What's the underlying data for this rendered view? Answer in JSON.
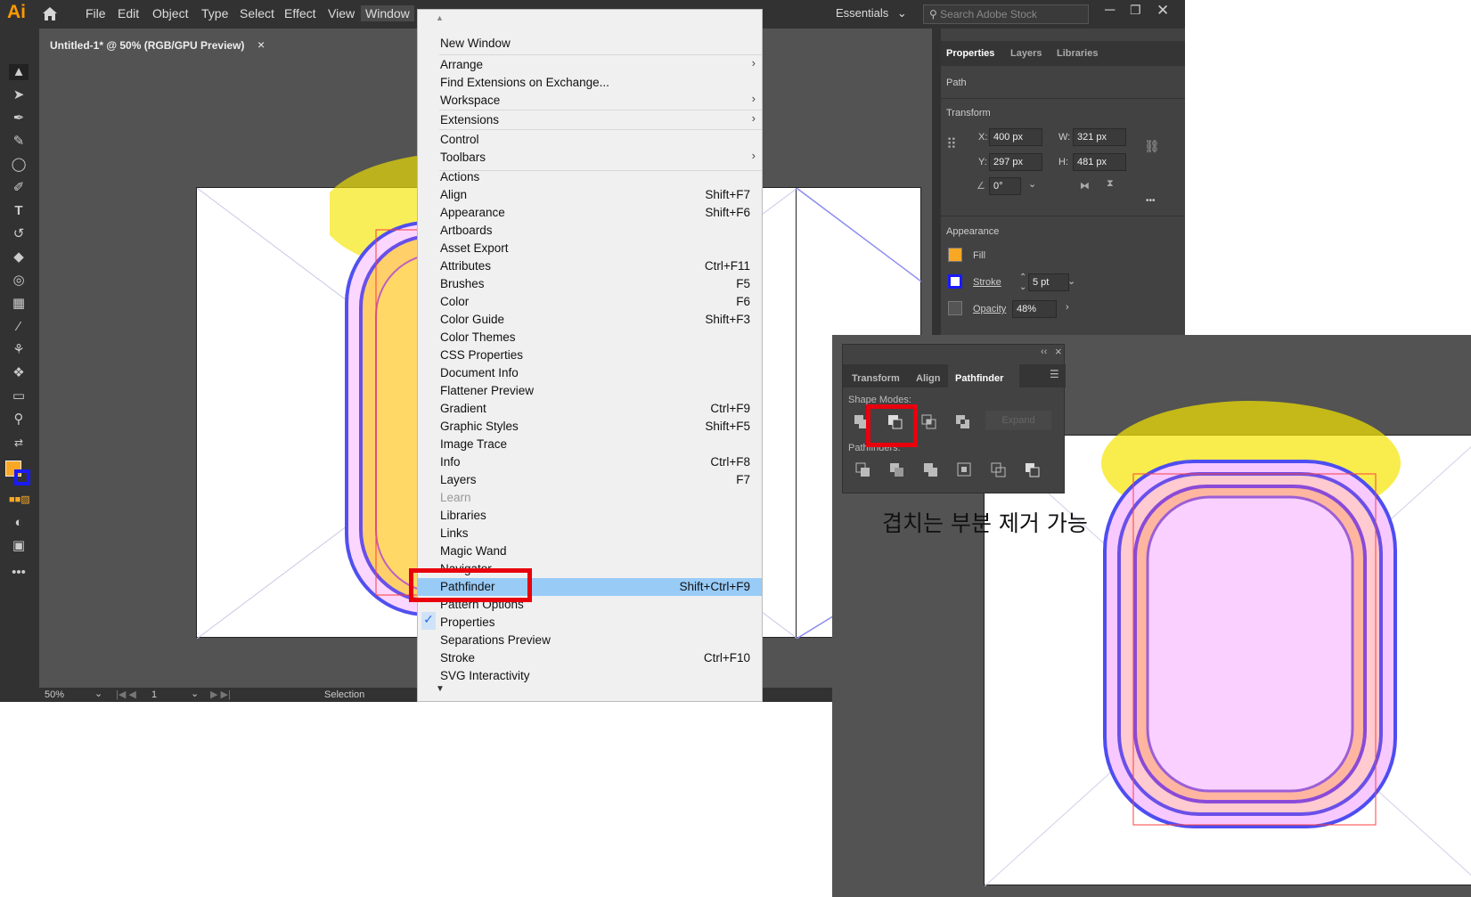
{
  "app": {
    "logo": "Ai",
    "menus": [
      "File",
      "Edit",
      "Object",
      "Type",
      "Select",
      "Effect",
      "View",
      "Window"
    ],
    "workspace": "Essentials",
    "search_placeholder": "Search Adobe Stock",
    "doc_tab": "Untitled-1* @ 50% (RGB/GPU Preview)",
    "tab_close": "×"
  },
  "status": {
    "zoom": "50%",
    "page": "1",
    "tool_name": "Selection"
  },
  "properties": {
    "tabs": [
      "Properties",
      "Layers",
      "Libraries"
    ],
    "object_type": "Path",
    "transform_title": "Transform",
    "x_label": "X:",
    "x_value": "400 px",
    "y_label": "Y:",
    "y_value": "297 px",
    "w_label": "W:",
    "w_value": "321 px",
    "h_label": "H:",
    "h_value": "481 px",
    "rotate_value": "0°",
    "appearance_title": "Appearance",
    "fill_label": "Fill",
    "stroke_label": "Stroke",
    "stroke_value": "5 pt",
    "opacity_label": "Opacity",
    "opacity_value": "48%",
    "more": "•••"
  },
  "colors": {
    "fill": "#f9a825",
    "stroke": "#1a1aff",
    "menu_highlight": "#99cbf7",
    "callout": "#e8000d"
  },
  "window_menu": {
    "items": [
      {
        "label": "New Window",
        "shortcut": "",
        "submenu": false
      },
      {
        "label": "Arrange",
        "shortcut": "",
        "submenu": true
      },
      {
        "label": "Find Extensions on Exchange...",
        "shortcut": "",
        "submenu": false
      },
      {
        "label": "Workspace",
        "shortcut": "",
        "submenu": true
      },
      {
        "label": "Extensions",
        "shortcut": "",
        "submenu": true
      },
      {
        "label": "Control",
        "shortcut": "",
        "submenu": false
      },
      {
        "label": "Toolbars",
        "shortcut": "",
        "submenu": true
      },
      {
        "label": "Actions",
        "shortcut": "",
        "submenu": false
      },
      {
        "label": "Align",
        "shortcut": "Shift+F7",
        "submenu": false
      },
      {
        "label": "Appearance",
        "shortcut": "Shift+F6",
        "submenu": false
      },
      {
        "label": "Artboards",
        "shortcut": "",
        "submenu": false
      },
      {
        "label": "Asset Export",
        "shortcut": "",
        "submenu": false
      },
      {
        "label": "Attributes",
        "shortcut": "Ctrl+F11",
        "submenu": false
      },
      {
        "label": "Brushes",
        "shortcut": "F5",
        "submenu": false
      },
      {
        "label": "Color",
        "shortcut": "F6",
        "submenu": false
      },
      {
        "label": "Color Guide",
        "shortcut": "Shift+F3",
        "submenu": false
      },
      {
        "label": "Color Themes",
        "shortcut": "",
        "submenu": false
      },
      {
        "label": "CSS Properties",
        "shortcut": "",
        "submenu": false
      },
      {
        "label": "Document Info",
        "shortcut": "",
        "submenu": false
      },
      {
        "label": "Flattener Preview",
        "shortcut": "",
        "submenu": false
      },
      {
        "label": "Gradient",
        "shortcut": "Ctrl+F9",
        "submenu": false
      },
      {
        "label": "Graphic Styles",
        "shortcut": "Shift+F5",
        "submenu": false
      },
      {
        "label": "Image Trace",
        "shortcut": "",
        "submenu": false
      },
      {
        "label": "Info",
        "shortcut": "Ctrl+F8",
        "submenu": false
      },
      {
        "label": "Layers",
        "shortcut": "F7",
        "submenu": false
      },
      {
        "label": "Learn",
        "shortcut": "",
        "submenu": false,
        "disabled": true
      },
      {
        "label": "Libraries",
        "shortcut": "",
        "submenu": false
      },
      {
        "label": "Links",
        "shortcut": "",
        "submenu": false
      },
      {
        "label": "Magic Wand",
        "shortcut": "",
        "submenu": false
      },
      {
        "label": "Navigator",
        "shortcut": "",
        "submenu": false
      },
      {
        "label": "Pathfinder",
        "shortcut": "Shift+Ctrl+F9",
        "submenu": false,
        "selected": true
      },
      {
        "label": "Pattern Options",
        "shortcut": "",
        "submenu": false
      },
      {
        "label": "Properties",
        "shortcut": "",
        "submenu": false,
        "checked": true
      },
      {
        "label": "Separations Preview",
        "shortcut": "",
        "submenu": false
      },
      {
        "label": "Stroke",
        "shortcut": "Ctrl+F10",
        "submenu": false
      },
      {
        "label": "SVG Interactivity",
        "shortcut": "",
        "submenu": false
      }
    ]
  },
  "pathfinder_panel": {
    "tabs": [
      "Transform",
      "Align",
      "Pathfinder"
    ],
    "shape_modes_label": "Shape Modes:",
    "expand_label": "Expand",
    "pathfinders_label": "Pathfinders:",
    "collapse": "‹‹",
    "close": "×"
  },
  "annotation": {
    "text": "겹치는 부분 제거 가능"
  }
}
